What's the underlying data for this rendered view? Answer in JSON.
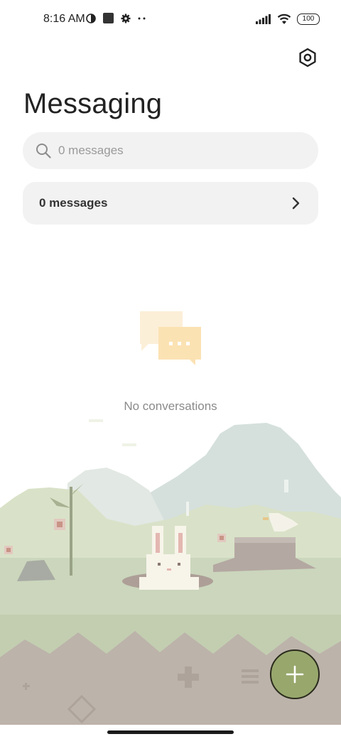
{
  "status_bar": {
    "time": "8:16 AM",
    "battery": "100",
    "icons": [
      "data-saver-icon",
      "square-notification-icon",
      "gear-notification-icon",
      "more-dots-icon",
      "signal-icon",
      "wifi-icon",
      "battery-icon"
    ]
  },
  "header": {
    "title": "Messaging",
    "settings_icon": "hexagon-settings-icon"
  },
  "search": {
    "placeholder": "0 messages"
  },
  "messages_card": {
    "label": "0 messages"
  },
  "empty_state": {
    "icon": "chat-bubbles-icon",
    "text": "No conversations"
  },
  "fab": {
    "icon": "plus-icon",
    "color": "#98a86d"
  },
  "colors": {
    "surface": "#f2f2f2",
    "mountain": "#cfdcd9",
    "grass": "#c8d4b6",
    "ground": "#b9b2aa"
  }
}
